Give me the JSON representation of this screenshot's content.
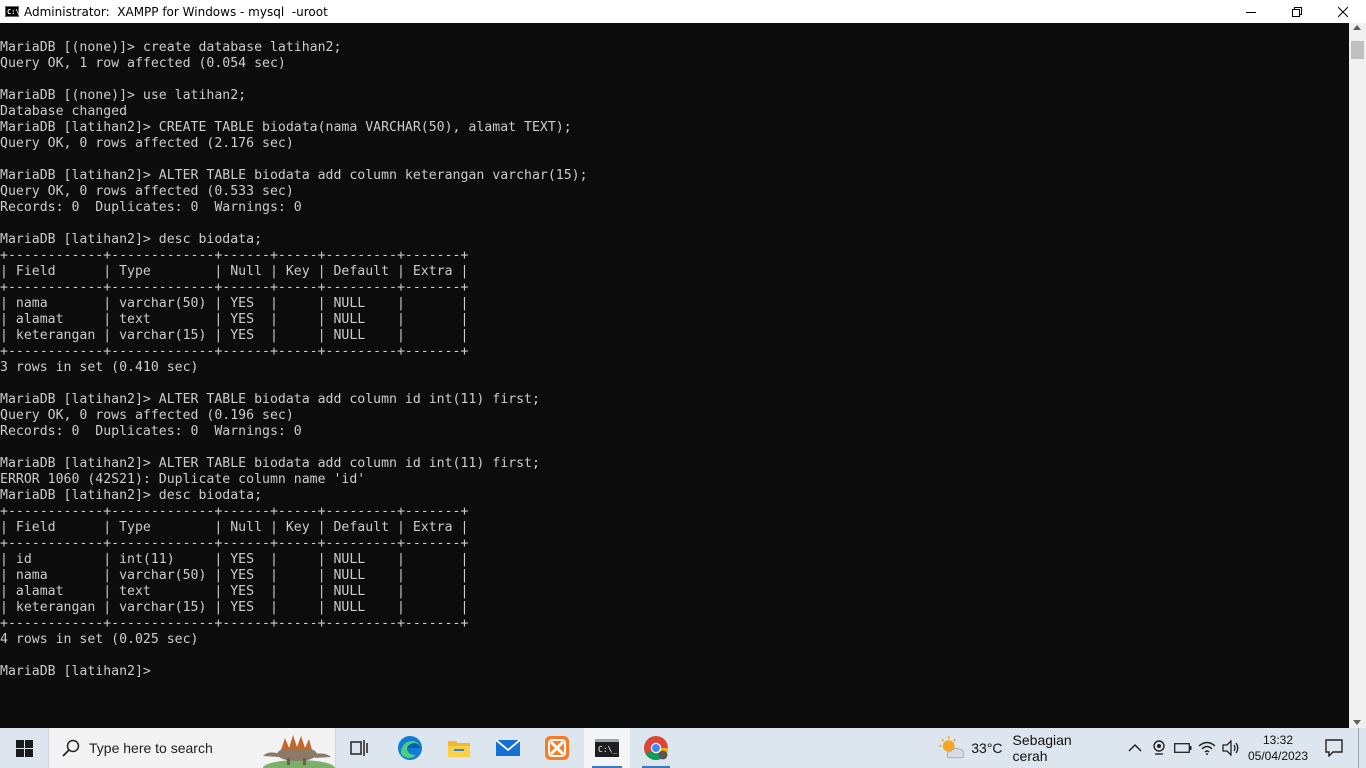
{
  "window": {
    "title": "Administrator:  XAMPP for Windows - mysql  -uroot",
    "icon_text": "C:\\",
    "icon": "console-icon",
    "controls": [
      "minimize-icon",
      "restore-icon",
      "close-icon"
    ]
  },
  "terminal": {
    "text": "MariaDB [(none)]> create database latihan2;\nQuery OK, 1 row affected (0.054 sec)\n\nMariaDB [(none)]> use latihan2;\nDatabase changed\nMariaDB [latihan2]> CREATE TABLE biodata(nama VARCHAR(50), alamat TEXT);\nQuery OK, 0 rows affected (2.176 sec)\n\nMariaDB [latihan2]> ALTER TABLE biodata add column keterangan varchar(15);\nQuery OK, 0 rows affected (0.533 sec)\nRecords: 0  Duplicates: 0  Warnings: 0\n\nMariaDB [latihan2]> desc biodata;\n+------------+-------------+------+-----+---------+-------+\n| Field      | Type        | Null | Key | Default | Extra |\n+------------+-------------+------+-----+---------+-------+\n| nama       | varchar(50) | YES  |     | NULL    |       |\n| alamat     | text        | YES  |     | NULL    |       |\n| keterangan | varchar(15) | YES  |     | NULL    |       |\n+------------+-------------+------+-----+---------+-------+\n3 rows in set (0.410 sec)\n\nMariaDB [latihan2]> ALTER TABLE biodata add column id int(11) first;\nQuery OK, 0 rows affected (0.196 sec)\nRecords: 0  Duplicates: 0  Warnings: 0\n\nMariaDB [latihan2]> ALTER TABLE biodata add column id int(11) first;\nERROR 1060 (42S21): Duplicate column name 'id'\nMariaDB [latihan2]> desc biodata;\n+------------+-------------+------+-----+---------+-------+\n| Field      | Type        | Null | Key | Default | Extra |\n+------------+-------------+------+-----+---------+-------+\n| id         | int(11)     | YES  |     | NULL    |       |\n| nama       | varchar(50) | YES  |     | NULL    |       |\n| alamat     | text        | YES  |     | NULL    |       |\n| keterangan | varchar(15) | YES  |     | NULL    |       |\n+------------+-------------+------+-----+---------+-------+\n4 rows in set (0.025 sec)\n\nMariaDB [latihan2]> ",
    "foreground": "#cccccc",
    "background": "#0c0c0c"
  },
  "taskbar": {
    "search_placeholder": "Type here to search",
    "apps": [
      "task-view-icon",
      "edge-icon",
      "file-explorer-icon",
      "mail-icon",
      "xampp-icon",
      "terminal-icon",
      "chrome-icon"
    ],
    "weather": {
      "temperature": "33°C",
      "condition": "Sebagian cerah"
    },
    "clock": {
      "time": "13:32",
      "date": "05/04/2023"
    }
  }
}
